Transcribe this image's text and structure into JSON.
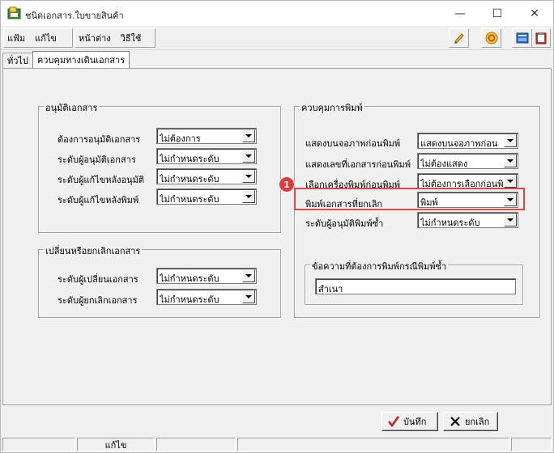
{
  "window": {
    "title": "ชนิดเอกสาร.ใบขายสินค้า",
    "min_glyph": "—",
    "max_glyph": "☐",
    "close_glyph": "✕"
  },
  "menu": {
    "file": "แฟ้ม",
    "edit": "แก้ไข",
    "window": "หน้าต่าง",
    "help": "วิธีใช้"
  },
  "tabs": [
    {
      "label": "ทั่วไป",
      "active": false
    },
    {
      "label": "ควบคุมทางเดินเอกสาร",
      "active": true
    }
  ],
  "approve_group": {
    "title": "อนุมัติเอกสาร",
    "rows": [
      {
        "label": "ต้องการอนุมัติเอกสาร",
        "value": "ไม่ต้องการ"
      },
      {
        "label": "ระดับผู้อนุมัติเอกสาร",
        "value": "ไม่กำหนดระดับ"
      },
      {
        "label": "ระดับผู้แก้ไขหลังอนุมัติ",
        "value": "ไม่กำหนดระดับ"
      },
      {
        "label": "ระดับผู้แก้ไขหลังพิมพ์",
        "value": "ไม่กำหนดระดับ"
      }
    ]
  },
  "change_group": {
    "title": "เปลี่ยนหรือยกเลิกเอกสาร",
    "rows": [
      {
        "label": "ระดับผู้เปลี่ยนเอกสาร",
        "value": "ไม่กำหนดระดับ"
      },
      {
        "label": "ระดับผู้ยกเลิกเอกสาร",
        "value": "ไม่กำหนดระดับ"
      }
    ]
  },
  "print_group": {
    "title": "ควบคุมการพิมพ์",
    "rows": [
      {
        "label": "แสดงบนจอภาพก่อนพิมพ์",
        "value": "แสดงบนจอภาพก่อน"
      },
      {
        "label": "แสดงเลขที่เอกสารก่อนพิมพ์",
        "value": "ไม่ต้องแสดง"
      },
      {
        "label": "เลือกเครื่องพิมพ์ก่อนพิมพ์",
        "value": "ไม่ต้องการเลือกก่อนพิ"
      },
      {
        "label": "พิมพ์เอกสารที่ยกเลิก",
        "value": "พิมพ์"
      },
      {
        "label": "ระดับผู้อนุมัติพิมพ์ซ้ำ",
        "value": "ไม่กำหนดระดับ"
      }
    ],
    "reprint_group": {
      "title": "ข้อความที่ต้องการพิมพ์กรณีพิมพ์ซ้ำ",
      "value": "สำเนา"
    }
  },
  "annotation": {
    "badge": "1",
    "color": "#e04848"
  },
  "buttons": {
    "save": "บันทึก",
    "cancel": "ยกเลิก"
  },
  "statusbar": {
    "mode": "แก้ไข"
  }
}
